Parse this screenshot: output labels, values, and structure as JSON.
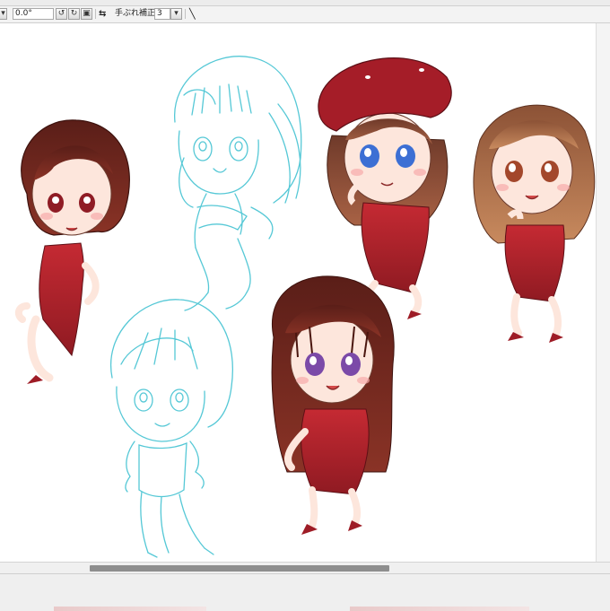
{
  "toolbar": {
    "angle_value": "0.0°",
    "stabilization_label": "手ぶれ補正",
    "stabilization_value": "3"
  },
  "icons": {
    "rotate_left": "rotate-left-icon",
    "rotate_right": "rotate-right-icon",
    "reset_rotation": "reset-rotation-icon",
    "flip": "flip-icon",
    "swap": "swap-icon",
    "pen": "pen-icon"
  },
  "colors": {
    "sketch_line": "#55c8d6",
    "dress": "#b3232b",
    "hair_dark": "#6e2a22",
    "hair_brown": "#8a4a30",
    "skin": "#fce4da",
    "scroll_thumb": "#8e8e8e"
  },
  "scrollbar": {
    "horizontal_position_fraction": 0.15,
    "horizontal_visible_fraction": 0.5
  }
}
